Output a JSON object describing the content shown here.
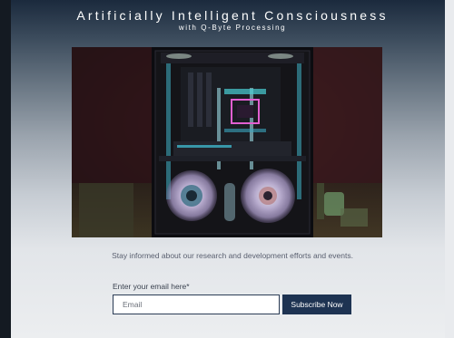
{
  "header": {
    "title": "Artificially Intelligent Consciousness",
    "subtitle": "with Q-Byte Processing"
  },
  "newsletter": {
    "info_text": "Stay informed about our research and development efforts and events.",
    "email_label": "Enter your email here*",
    "email_placeholder": "Email",
    "email_value": "",
    "subscribe_label": "Subscribe Now"
  },
  "colors": {
    "header_gradient_top": "#1b2a3d",
    "page_bottom": "#eceef0",
    "button_bg": "#1e3352",
    "input_border": "#2b3c55",
    "fan_glow": "#d6c8ef",
    "accent_cyan": "#3fb3c8"
  }
}
